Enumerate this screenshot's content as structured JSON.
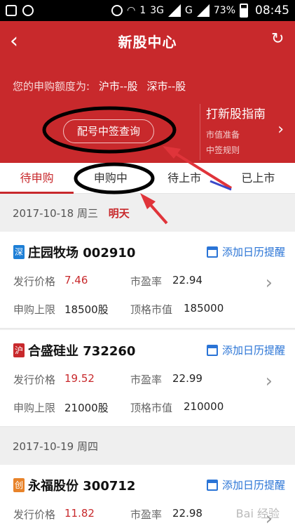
{
  "status_bar": {
    "network_3g": "3G",
    "network_g": "G",
    "sim_label": "1",
    "battery": "73%",
    "time": "08:45"
  },
  "header": {
    "back_icon": "‹",
    "title": "新股中心",
    "refresh_icon": "↻",
    "quota_label": "您的申购额度为:",
    "quota_sh": "沪市--股",
    "quota_sz": "深市--股",
    "query_button": "配号中签查询",
    "guide_title": "打新股指南",
    "guide_items": [
      "市值准备",
      "中签规则"
    ],
    "guide_chevron": "›"
  },
  "tabs": [
    {
      "label": "待申购",
      "active": true
    },
    {
      "label": "申购中",
      "active": false
    },
    {
      "label": "待上市",
      "active": false
    },
    {
      "label": "已上市",
      "active": false
    }
  ],
  "groups": [
    {
      "date": "2017-10-18 周三",
      "tag": "明天"
    },
    {
      "date": "2017-10-19 周四",
      "tag": ""
    }
  ],
  "stocks": [
    {
      "badge": "深",
      "badge_color": "#1e7fd6",
      "name": "庄园牧场 002910",
      "remind": "添加日历提醒",
      "issue_price_label": "发行价格",
      "issue_price": "7.46",
      "pe_label": "市盈率",
      "pe": "22.94",
      "limit_label": "申购上限",
      "limit": "18500股",
      "cap_label": "顶格市值",
      "cap": "185000"
    },
    {
      "badge": "沪",
      "badge_color": "#c8292c",
      "name": "合盛硅业 732260",
      "remind": "添加日历提醒",
      "issue_price_label": "发行价格",
      "issue_price": "19.52",
      "pe_label": "市盈率",
      "pe": "22.99",
      "limit_label": "申购上限",
      "limit": "21000股",
      "cap_label": "顶格市值",
      "cap": "210000"
    },
    {
      "badge": "创",
      "badge_color": "#e8832a",
      "name": "永福股份 300712",
      "remind": "添加日历提醒",
      "issue_price_label": "发行价格",
      "issue_price": "11.82",
      "pe_label": "市盈率",
      "pe": "22.98"
    }
  ],
  "colors": {
    "brand_red": "#c8292c",
    "link_blue": "#2a74d6",
    "annotation_arrow": "#e0343a",
    "annotation_ellipse": "#000000"
  },
  "watermark": "Bai 经验"
}
